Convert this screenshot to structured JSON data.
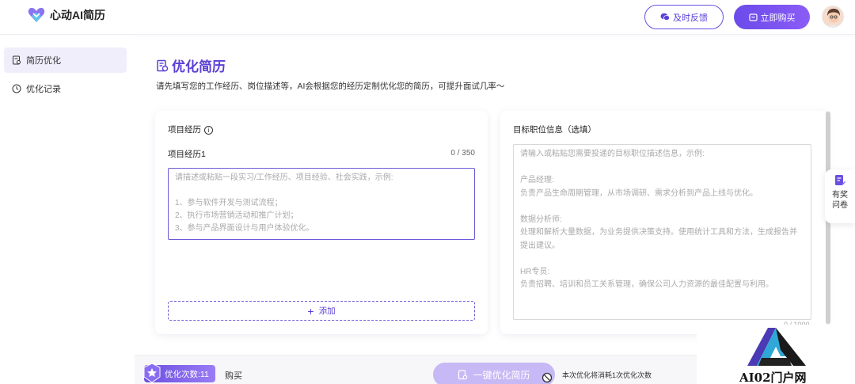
{
  "header": {
    "app_name": "心动AI简历",
    "feedback_label": "及时反馈",
    "buy_label": "立即购买"
  },
  "sidebar": {
    "items": [
      {
        "label": "简历优化",
        "icon": "resume-icon",
        "active": true
      },
      {
        "label": "优化记录",
        "icon": "history-icon",
        "active": false
      }
    ]
  },
  "main": {
    "title": "优化简历",
    "subtitle": "请先填写您的工作经历、岗位描述等，AI会根据您的经历定制优化您的简历，可提升面试几率～",
    "left_card": {
      "header": "项目经历",
      "item_label": "项目经历1",
      "count": "0 / 350",
      "placeholder": "请描述或粘贴一段实习/工作经历、项目经验、社会实践，示例:\n\n1、参与软件开发与测试流程；\n2、执行市场营销活动和推广计划；\n3、参与产品界面设计与用户体验优化。",
      "add_label": "添加"
    },
    "right_card": {
      "header": "目标职位信息（选填）",
      "placeholder": "请输入或粘贴您需要投递的目标职位描述信息，示例:\n\n产品经理:\n负责产品生命周期管理，从市场调研、需求分析到产品上线与优化。\n\n数据分析师:\n处理和解析大量数据，为业务提供决策支持。使用统计工具和方法，生成报告并提出建议。\n\nHR专员:\n负责招聘、培训和员工关系管理，确保公司人力资源的最佳配置与利用。",
      "count": "0 / 1000"
    },
    "reward_label": "有奖问卷"
  },
  "bottom": {
    "quota": "优化次数:11",
    "buy_link": "购买",
    "optimize_label": "一键优化简历",
    "note": "本次优化将消耗1次优化次数"
  },
  "watermark": {
    "text": "AI02门户网"
  },
  "colors": {
    "accent": "#5b3fd6",
    "accent_light": "#c7b9f5"
  }
}
